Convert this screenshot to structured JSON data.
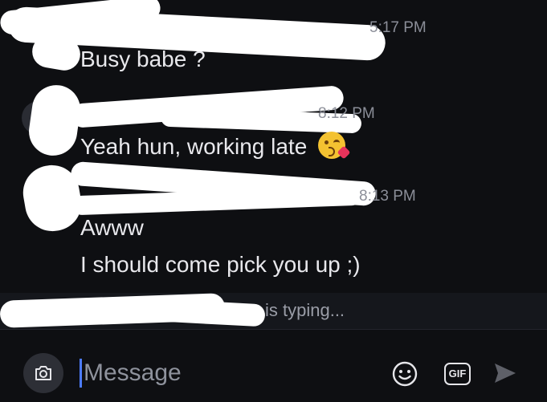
{
  "messages": [
    {
      "time": "5:17 PM",
      "lines": [
        "Busy babe ?"
      ]
    },
    {
      "time": "8:12 PM",
      "lines": [
        "Yeah hun, working late"
      ],
      "emoji": "kissing-face-heart"
    },
    {
      "time": "8:13 PM",
      "lines": [
        "Awww",
        "I should come pick you up ;)"
      ]
    }
  ],
  "typing": {
    "text": "is typing..."
  },
  "composer": {
    "placeholder": "Message",
    "gif_label": "GIF"
  },
  "colors": {
    "background": "#0e0f12",
    "caret": "#4d7cff",
    "redaction": "#ffffff"
  }
}
